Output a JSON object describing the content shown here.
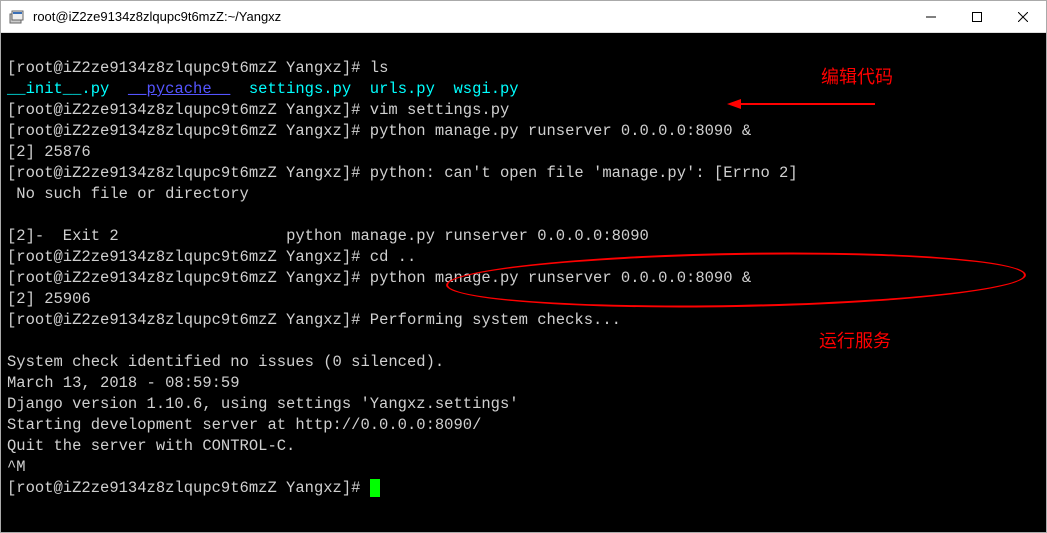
{
  "title": "root@iZ2ze9134z8zlqupc9t6mzZ:~/Yangxz",
  "terminal": {
    "prompt_user_host": "[root@iZ2ze9134z8zlqupc9t6mzZ Yangxz]#",
    "ls": "ls",
    "ls_out_init": "__init__.py",
    "ls_out_pycache": "__pycache__",
    "ls_out_rest": "  settings.py  urls.py  wsgi.py",
    "cmd_vim": "vim settings.py",
    "cmd_runserver1": "python manage.py runserver 0.0.0.0:8090 &",
    "job2a": "[2] 25876",
    "err_python": "python: can't open file 'manage.py': [Errno 2]",
    "err_nofile": " No such file or directory",
    "exit_line_left": "[2]-  Exit 2",
    "exit_line_right": "python manage.py runserver 0.0.0.0:8090",
    "cmd_cd": "cd ..",
    "cmd_runserver2": "python manage.py runserver 0.0.0.0:8090 &",
    "job2b": "[2] 25906",
    "perform": "Performing system checks...",
    "syscheck": "System check identified no issues (0 silenced).",
    "date": "March 13, 2018 - 08:59:59",
    "django": "Django version 1.10.6, using settings 'Yangxz.settings'",
    "starting": "Starting development server at http://0.0.0.0:8090/",
    "quit": "Quit the server with CONTROL-C.",
    "caret_m": "^M"
  },
  "annotations": {
    "edit_code": "编辑代码",
    "run_service": "运行服务"
  }
}
